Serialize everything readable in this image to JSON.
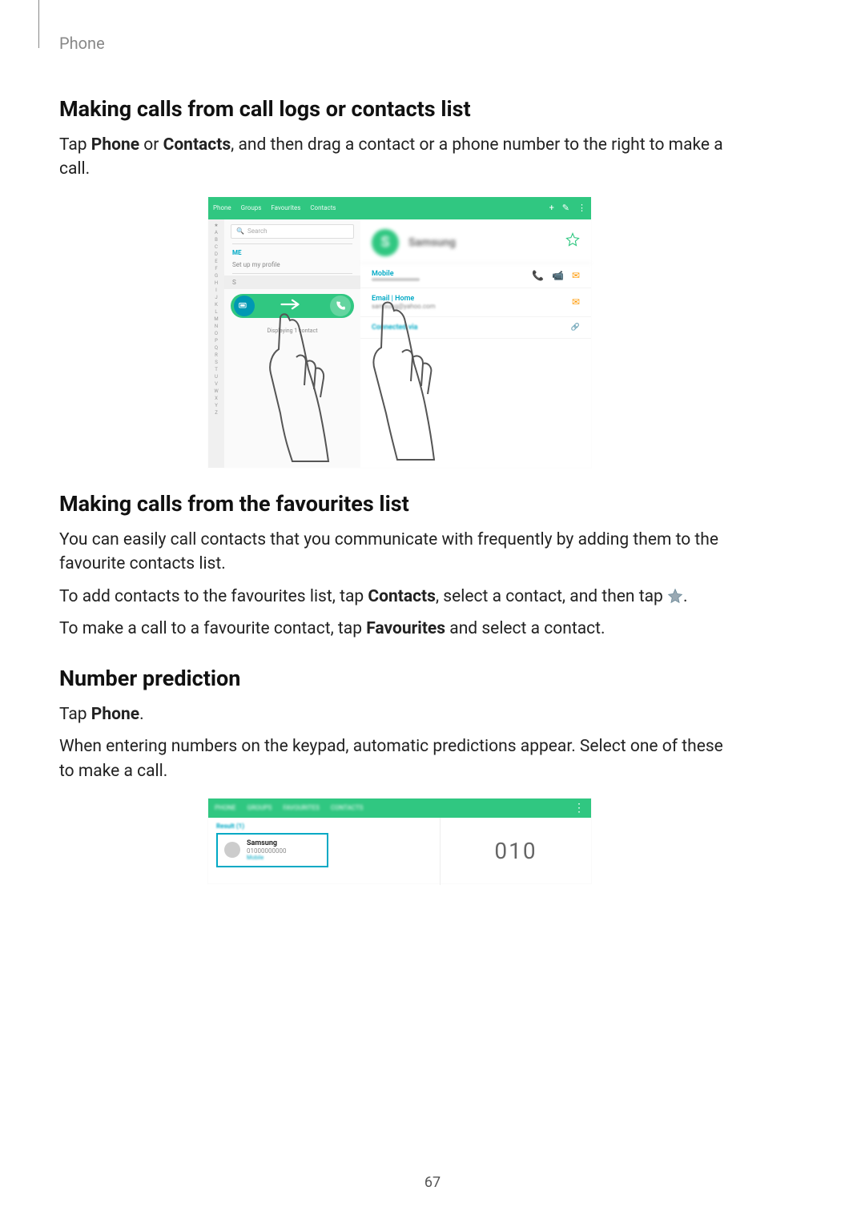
{
  "header": {
    "section": "Phone"
  },
  "page_number": "67",
  "sections": {
    "s1": {
      "title": "Making calls from call logs or contacts list",
      "p_pre": "Tap ",
      "b1": "Phone",
      "p_mid1": " or ",
      "b2": "Contacts",
      "p_post": ", and then drag a contact or a phone number to the right to make a call."
    },
    "s2": {
      "title": "Making calls from the favourites list",
      "p1": "You can easily call contacts that you communicate with frequently by adding them to the favourite contacts list.",
      "p2_pre": "To add contacts to the favourites list, tap ",
      "p2_b": "Contacts",
      "p2_post": ", select a contact, and then tap ",
      "p2_end": ".",
      "p3_pre": "To make a call to a favourite contact, tap ",
      "p3_b": "Favourites",
      "p3_post": " and select a contact."
    },
    "s3": {
      "title": "Number prediction",
      "p1_pre": "Tap ",
      "p1_b": "Phone",
      "p1_post": ".",
      "p2": "When entering numbers on the keypad, automatic predictions appear. Select one of these to make a call."
    }
  },
  "fig1": {
    "tabs": [
      "Phone",
      "Groups",
      "Favourites",
      "Contacts"
    ],
    "header_icons": [
      "+",
      "✎",
      "⋮"
    ],
    "index_letters": [
      "★",
      "A",
      "B",
      "C",
      "D",
      "E",
      "F",
      "G",
      "H",
      "I",
      "J",
      "K",
      "L",
      "M",
      "N",
      "O",
      "P",
      "Q",
      "R",
      "S",
      "T",
      "U",
      "V",
      "W",
      "X",
      "Y",
      "Z"
    ],
    "search_placeholder": "Search",
    "me_label": "ME",
    "setup": "Set up my profile",
    "s_header": "S",
    "displaying": "Displaying 1 contact",
    "contact_initial": "S",
    "contact_name": "Samsung",
    "mobile_label": "Mobile",
    "email_label": "Email | Home",
    "email_value": "samsung@yahoo.com",
    "connected": "Connected via"
  },
  "fig2": {
    "tabs": [
      "PHONE",
      "GROUPS",
      "FAVOURITES",
      "CONTACTS"
    ],
    "result_header": "Result (1)",
    "card": {
      "name": "Samsung",
      "number": "01000000000",
      "type": "Mobile"
    },
    "typed": "010"
  }
}
